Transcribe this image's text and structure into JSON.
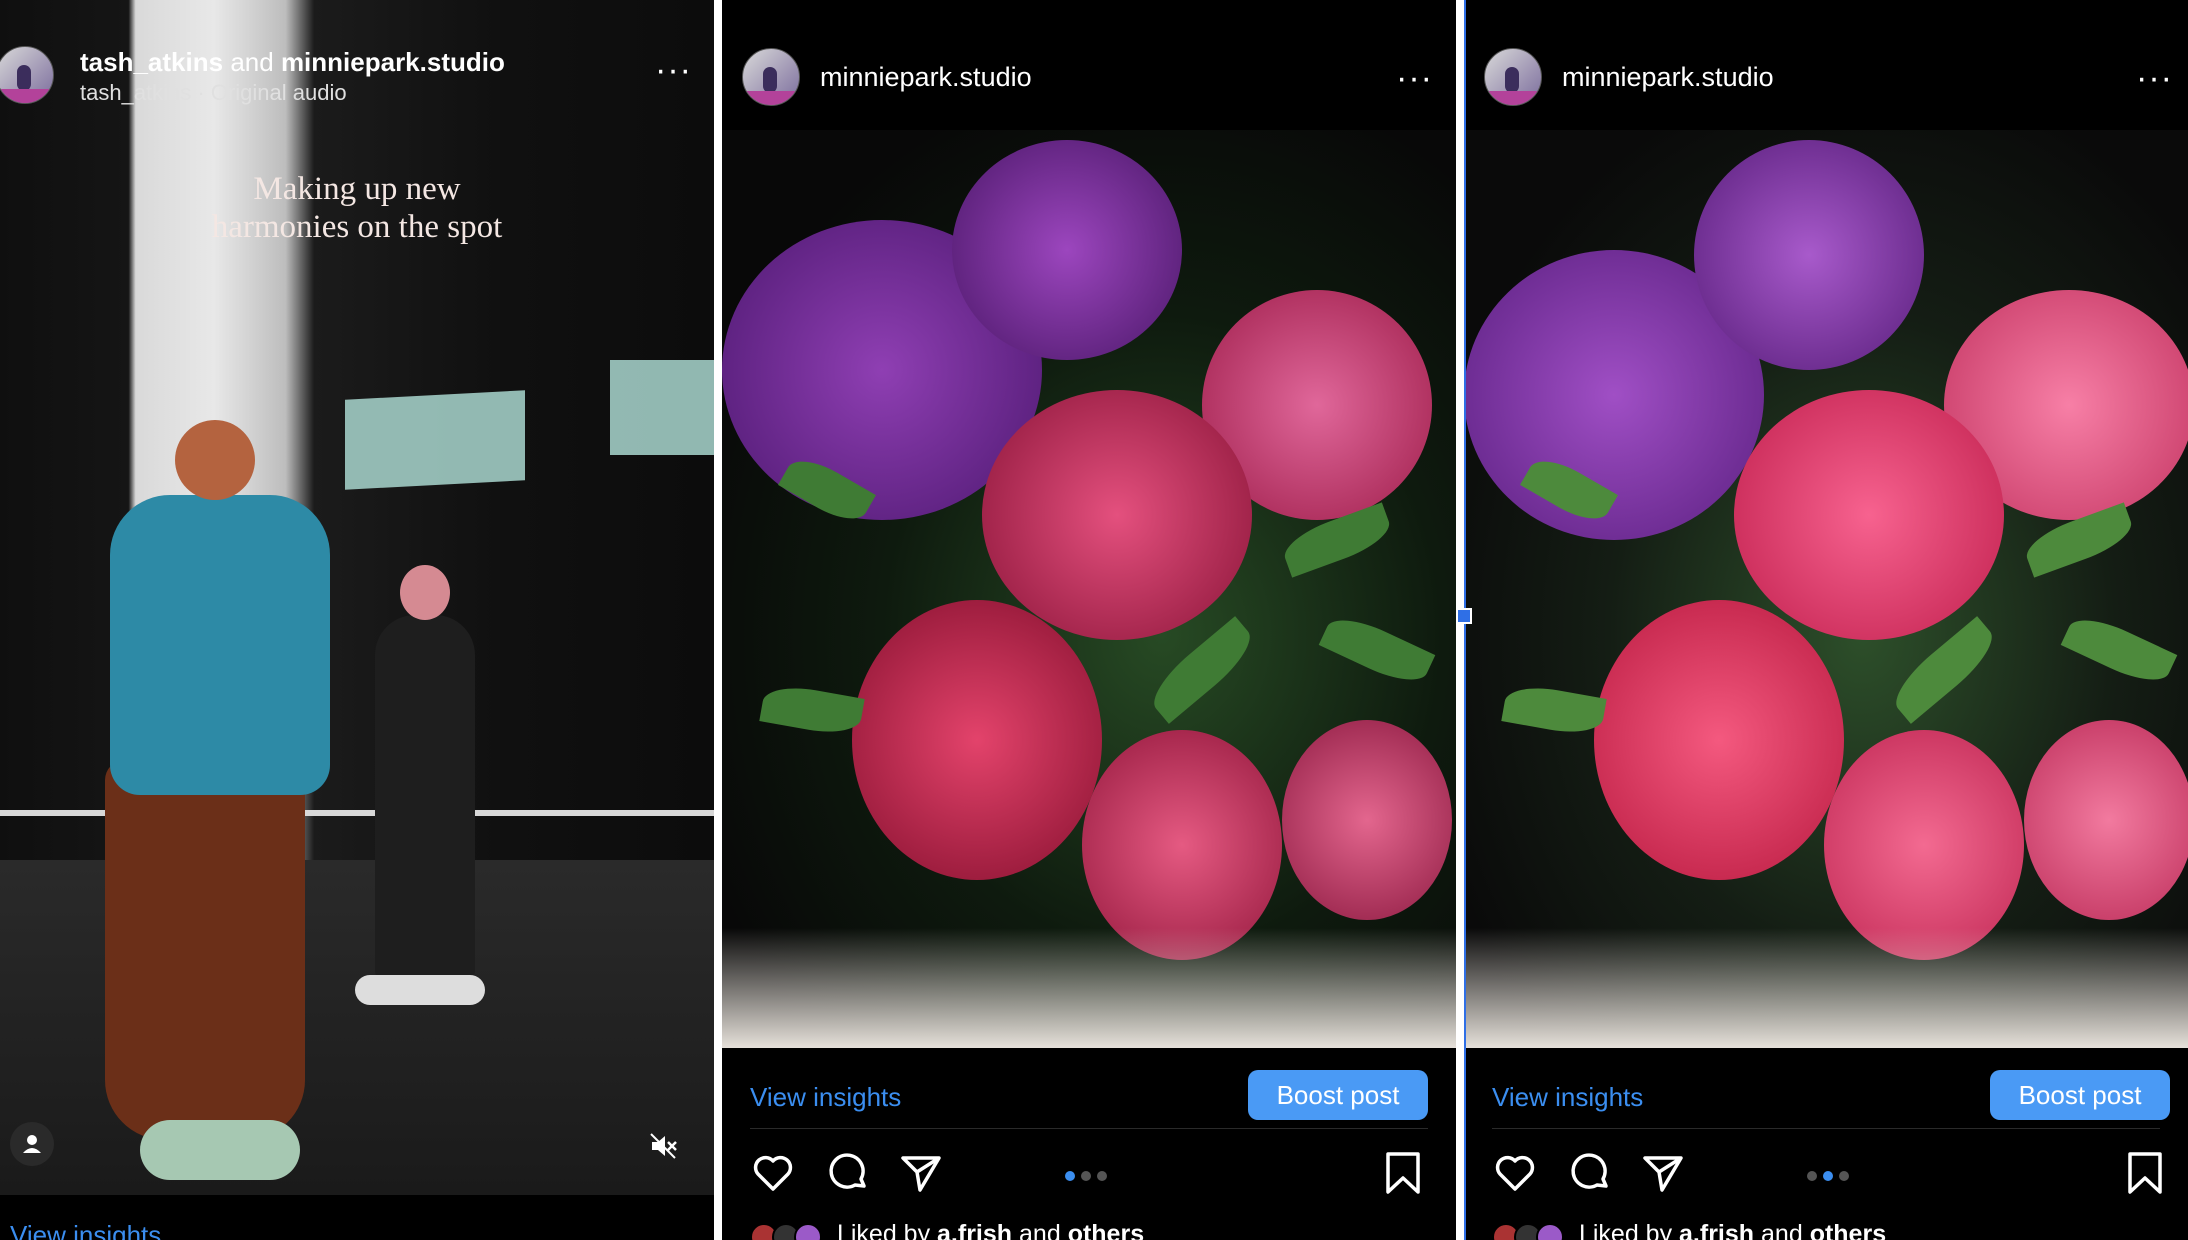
{
  "reel": {
    "user1": "tash_atkins",
    "and_text": "and",
    "user2": "minniepark.studio",
    "subtitle": "tash_atkins · Original audio",
    "caption_line1": "Making up new",
    "caption_line2": "harmonies on the spot",
    "more": "···",
    "insights_label": "View insights"
  },
  "posts": [
    {
      "username": "minniepark.studio",
      "more": "···",
      "insights_label": "View insights",
      "boost_label": "Boost post",
      "liked_prefix": "Liked by",
      "liked_user": "a.frish",
      "liked_and": "and",
      "liked_others": "others",
      "carousel_active": 1,
      "carousel_count": 3
    },
    {
      "username": "minniepark.studio",
      "more": "···",
      "insights_label": "View insights",
      "boost_label": "Boost post",
      "liked_prefix": "Liked by",
      "liked_user": "a.frish",
      "liked_and": "and",
      "liked_others": "others",
      "carousel_active": 2,
      "carousel_count": 3
    }
  ],
  "icons": [
    "heart-icon",
    "comment-icon",
    "share-icon",
    "bookmark-icon",
    "mute-icon",
    "person-icon",
    "more-icon"
  ],
  "colors": {
    "link": "#3b8ef0",
    "boost": "#4a9af5",
    "background": "#000000"
  }
}
